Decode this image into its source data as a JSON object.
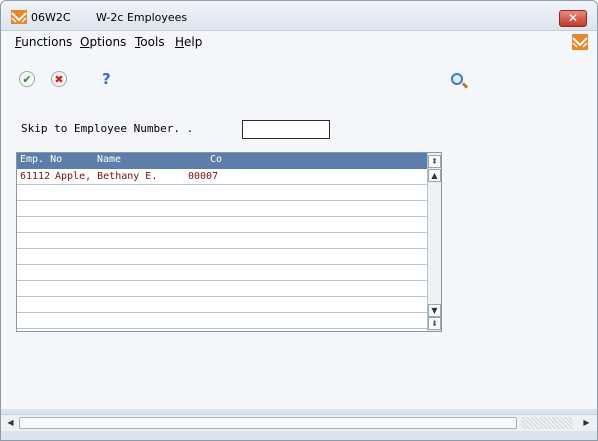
{
  "window": {
    "code": "06W2C",
    "title": "W-2c Employees",
    "close_glyph": "✕"
  },
  "menu": [
    {
      "underline": "F",
      "rest": "unctions"
    },
    {
      "underline": "O",
      "rest": "ptions"
    },
    {
      "underline": "T",
      "rest": "ools"
    },
    {
      "underline": "H",
      "rest": "elp"
    }
  ],
  "toolbar": {
    "ok_glyph": "✔",
    "cancel_glyph": "✖",
    "help_glyph": "?"
  },
  "form": {
    "skip_label": "Skip to Employee Number. .",
    "skip_value": ""
  },
  "grid": {
    "columns": [
      "Emp. No",
      "Name",
      "Co"
    ],
    "rows": [
      {
        "emp_no": "61112",
        "name": "Apple, Bethany E.",
        "co": "00007"
      },
      {
        "emp_no": "",
        "name": "",
        "co": ""
      },
      {
        "emp_no": "",
        "name": "",
        "co": ""
      },
      {
        "emp_no": "",
        "name": "",
        "co": ""
      },
      {
        "emp_no": "",
        "name": "",
        "co": ""
      },
      {
        "emp_no": "",
        "name": "",
        "co": ""
      },
      {
        "emp_no": "",
        "name": "",
        "co": ""
      },
      {
        "emp_no": "",
        "name": "",
        "co": ""
      },
      {
        "emp_no": "",
        "name": "",
        "co": ""
      },
      {
        "emp_no": "",
        "name": "",
        "co": ""
      }
    ],
    "scroll_top_glyph": "⇞",
    "scroll_up_glyph": "▲",
    "scroll_down_glyph": "▼",
    "scroll_bottom_glyph": "⇟"
  },
  "hscroll": {
    "left_glyph": "◀",
    "right_glyph": "▶"
  },
  "colors": {
    "header_bg": "#5c7ea8",
    "row_text": "#7a1010",
    "close_bg": "#c0392b"
  }
}
